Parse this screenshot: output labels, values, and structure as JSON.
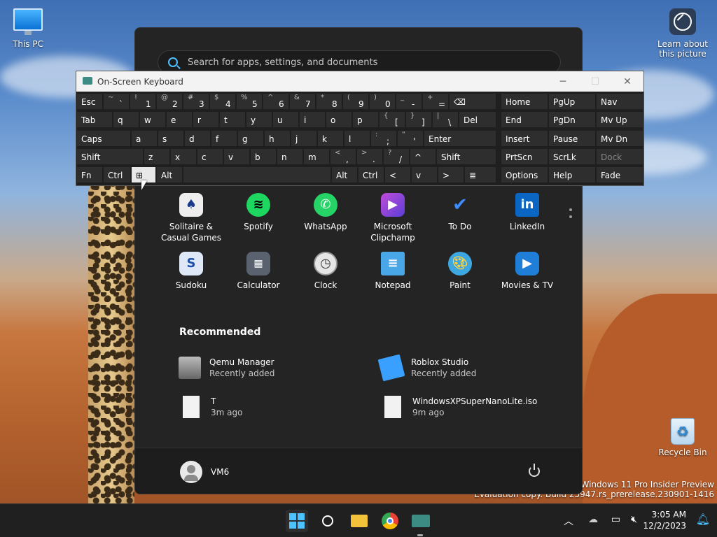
{
  "desktop": {
    "this_pc": "This PC",
    "learn_line1": "Learn about",
    "learn_line2": "this picture",
    "recycle_bin": "Recycle Bin",
    "watermark_line1": "Windows 11 Pro Insider Preview",
    "watermark_line2": "Evaluation copy. Build 25947.rs_prerelease.230901-1416"
  },
  "start_menu": {
    "search_placeholder": "Search for apps, settings, and documents",
    "apps": [
      {
        "label_line1": "Solitaire &",
        "label_line2": "Casual Games",
        "icon": "solitaire-icon",
        "color": "#2b2b2b"
      },
      {
        "label_line1": "Spotify",
        "label_line2": "",
        "icon": "spotify-icon",
        "color": "#1ed760"
      },
      {
        "label_line1": "WhatsApp",
        "label_line2": "",
        "icon": "whatsapp-icon",
        "color": "#25d366"
      },
      {
        "label_line1": "Microsoft",
        "label_line2": "Clipchamp",
        "icon": "clipchamp-icon",
        "color": "#7b3fe4"
      },
      {
        "label_line1": "To Do",
        "label_line2": "",
        "icon": "todo-icon",
        "color": "#2f6fe0"
      },
      {
        "label_line1": "LinkedIn",
        "label_line2": "",
        "icon": "linkedin-icon",
        "color": "#0a66c2"
      },
      {
        "label_line1": "Sudoku",
        "label_line2": "",
        "icon": "sudoku-icon",
        "color": "#2a5fb0"
      },
      {
        "label_line1": "Calculator",
        "label_line2": "",
        "icon": "calculator-icon",
        "color": "#5a6270"
      },
      {
        "label_line1": "Clock",
        "label_line2": "",
        "icon": "clock-icon",
        "color": "#d9d9d9"
      },
      {
        "label_line1": "Notepad",
        "label_line2": "",
        "icon": "notepad-icon",
        "color": "#49a7e8"
      },
      {
        "label_line1": "Paint",
        "label_line2": "",
        "icon": "paint-icon",
        "color": "#3fa7e0"
      },
      {
        "label_line1": "Movies & TV",
        "label_line2": "",
        "icon": "movies-tv-icon",
        "color": "#1f7fd8"
      }
    ],
    "recommended_title": "Recommended",
    "recommended": [
      {
        "name": "Qemu Manager",
        "sub": "Recently added",
        "icon": "qemu-icon"
      },
      {
        "name": "Roblox Studio",
        "sub": "Recently added",
        "icon": "roblox-studio-icon"
      },
      {
        "name": "T",
        "sub": "3m ago",
        "icon": "file-icon"
      },
      {
        "name": "WindowsXPSuperNanoLite.iso",
        "sub": "9m ago",
        "icon": "file-icon"
      }
    ],
    "user": "VM6"
  },
  "keyboard": {
    "title": "On-Screen Keyboard",
    "row1": [
      {
        "sup": "",
        "main": "Esc"
      },
      {
        "sup": "~",
        "main": "`"
      },
      {
        "sup": "!",
        "main": "1"
      },
      {
        "sup": "@",
        "main": "2"
      },
      {
        "sup": "#",
        "main": "3"
      },
      {
        "sup": "$",
        "main": "4"
      },
      {
        "sup": "%",
        "main": "5"
      },
      {
        "sup": "^",
        "main": "6"
      },
      {
        "sup": "&",
        "main": "7"
      },
      {
        "sup": "*",
        "main": "8"
      },
      {
        "sup": "(",
        "main": "9"
      },
      {
        "sup": ")",
        "main": "0"
      },
      {
        "sup": "_",
        "main": "-"
      },
      {
        "sup": "+",
        "main": "="
      },
      {
        "sup": "",
        "main": "⌫"
      }
    ],
    "row2": [
      {
        "sup": "",
        "main": "Tab"
      },
      {
        "sup": "",
        "main": "q"
      },
      {
        "sup": "",
        "main": "w"
      },
      {
        "sup": "",
        "main": "e"
      },
      {
        "sup": "",
        "main": "r"
      },
      {
        "sup": "",
        "main": "t"
      },
      {
        "sup": "",
        "main": "y"
      },
      {
        "sup": "",
        "main": "u"
      },
      {
        "sup": "",
        "main": "i"
      },
      {
        "sup": "",
        "main": "o"
      },
      {
        "sup": "",
        "main": "p"
      },
      {
        "sup": "{",
        "main": "["
      },
      {
        "sup": "}",
        "main": "]"
      },
      {
        "sup": "|",
        "main": "\\"
      },
      {
        "sup": "",
        "main": "Del"
      }
    ],
    "row3": [
      {
        "sup": "",
        "main": "Caps"
      },
      {
        "sup": "",
        "main": "a"
      },
      {
        "sup": "",
        "main": "s"
      },
      {
        "sup": "",
        "main": "d"
      },
      {
        "sup": "",
        "main": "f"
      },
      {
        "sup": "",
        "main": "g"
      },
      {
        "sup": "",
        "main": "h"
      },
      {
        "sup": "",
        "main": "j"
      },
      {
        "sup": "",
        "main": "k"
      },
      {
        "sup": "",
        "main": "l"
      },
      {
        "sup": ":",
        "main": ";"
      },
      {
        "sup": "\"",
        "main": "'"
      },
      {
        "sup": "",
        "main": "Enter"
      }
    ],
    "row4": [
      {
        "sup": "",
        "main": "Shift"
      },
      {
        "sup": "",
        "main": "z"
      },
      {
        "sup": "",
        "main": "x"
      },
      {
        "sup": "",
        "main": "c"
      },
      {
        "sup": "",
        "main": "v"
      },
      {
        "sup": "",
        "main": "b"
      },
      {
        "sup": "",
        "main": "n"
      },
      {
        "sup": "",
        "main": "m"
      },
      {
        "sup": "<",
        "main": ","
      },
      {
        "sup": ">",
        "main": "."
      },
      {
        "sup": "?",
        "main": "/"
      },
      {
        "sup": "",
        "main": "^"
      },
      {
        "sup": "",
        "main": "Shift"
      }
    ],
    "row5": {
      "fn": "Fn",
      "ctrl": "Ctrl",
      "alt": "Alt",
      "alt_r": "Alt",
      "ctrl_r": "Ctrl",
      "left": "<",
      "down": "v",
      "right": ">",
      "menu": "≣"
    },
    "nav": [
      [
        "Home",
        "PgUp",
        "Nav"
      ],
      [
        "End",
        "PgDn",
        "Mv Up"
      ],
      [
        "Insert",
        "Pause",
        "Mv Dn"
      ],
      [
        "PrtScn",
        "ScrLk",
        "Dock"
      ],
      [
        "Options",
        "Help",
        "Fade"
      ]
    ]
  },
  "taskbar": {
    "time": "3:05 AM",
    "date": "12/2/2023"
  }
}
